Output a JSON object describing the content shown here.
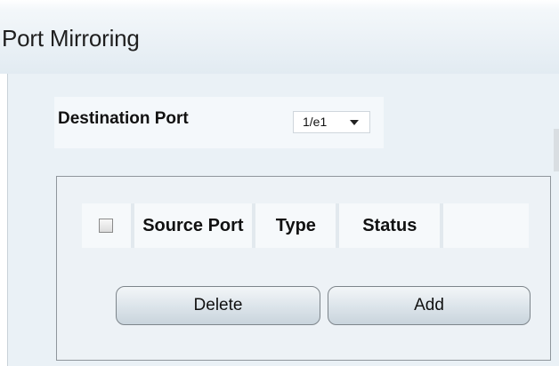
{
  "page": {
    "title": "Port Mirroring"
  },
  "destination": {
    "label": "Destination Port",
    "selected_value": "1/e1"
  },
  "source_table": {
    "columns": [
      "",
      "Source Port",
      "Type",
      "Status",
      ""
    ]
  },
  "buttons": {
    "delete_label": "Delete",
    "add_label": "Add"
  }
}
